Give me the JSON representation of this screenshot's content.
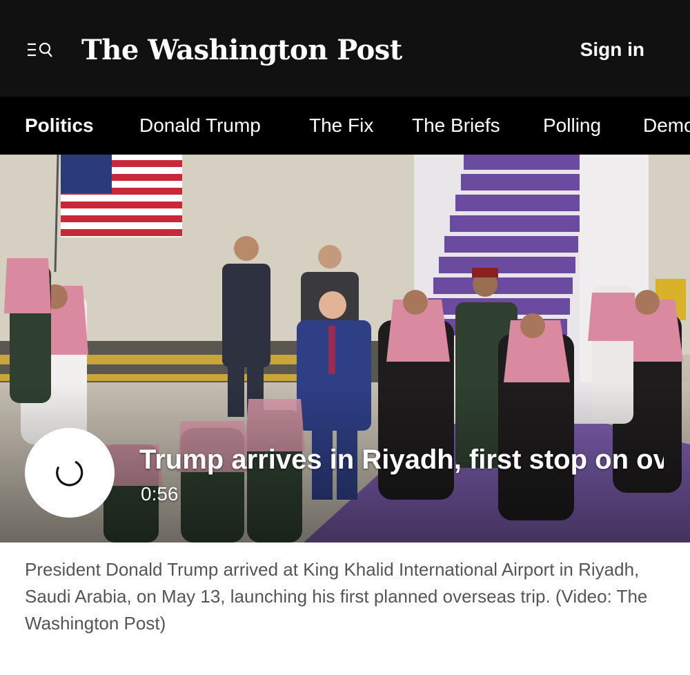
{
  "header": {
    "logo_text": "The Washington Post",
    "signin_label": "Sign in",
    "menu_icon": "menu-search-icon"
  },
  "nav": {
    "items": [
      {
        "label": "Politics",
        "active": true
      },
      {
        "label": "Donald Trump"
      },
      {
        "label": "The Fix"
      },
      {
        "label": "The Briefs"
      },
      {
        "label": "Polling"
      },
      {
        "label": "Democracy Dies"
      }
    ]
  },
  "video": {
    "title": "Trump arrives in Riyadh, first stop on overseas trip",
    "duration": "0:56",
    "play_icon": "loading-spinner-icon"
  },
  "caption": "President Donald Trump arrived at King Khalid International Airport in Riyadh, Saudi Arabia, on May 13, launching his first planned overseas trip. (Video: The Washington Post)",
  "colors": {
    "header_bg": "#111111",
    "nav_bg": "#000000",
    "caption_text": "#555555",
    "carpet": "#6a4ba0"
  }
}
